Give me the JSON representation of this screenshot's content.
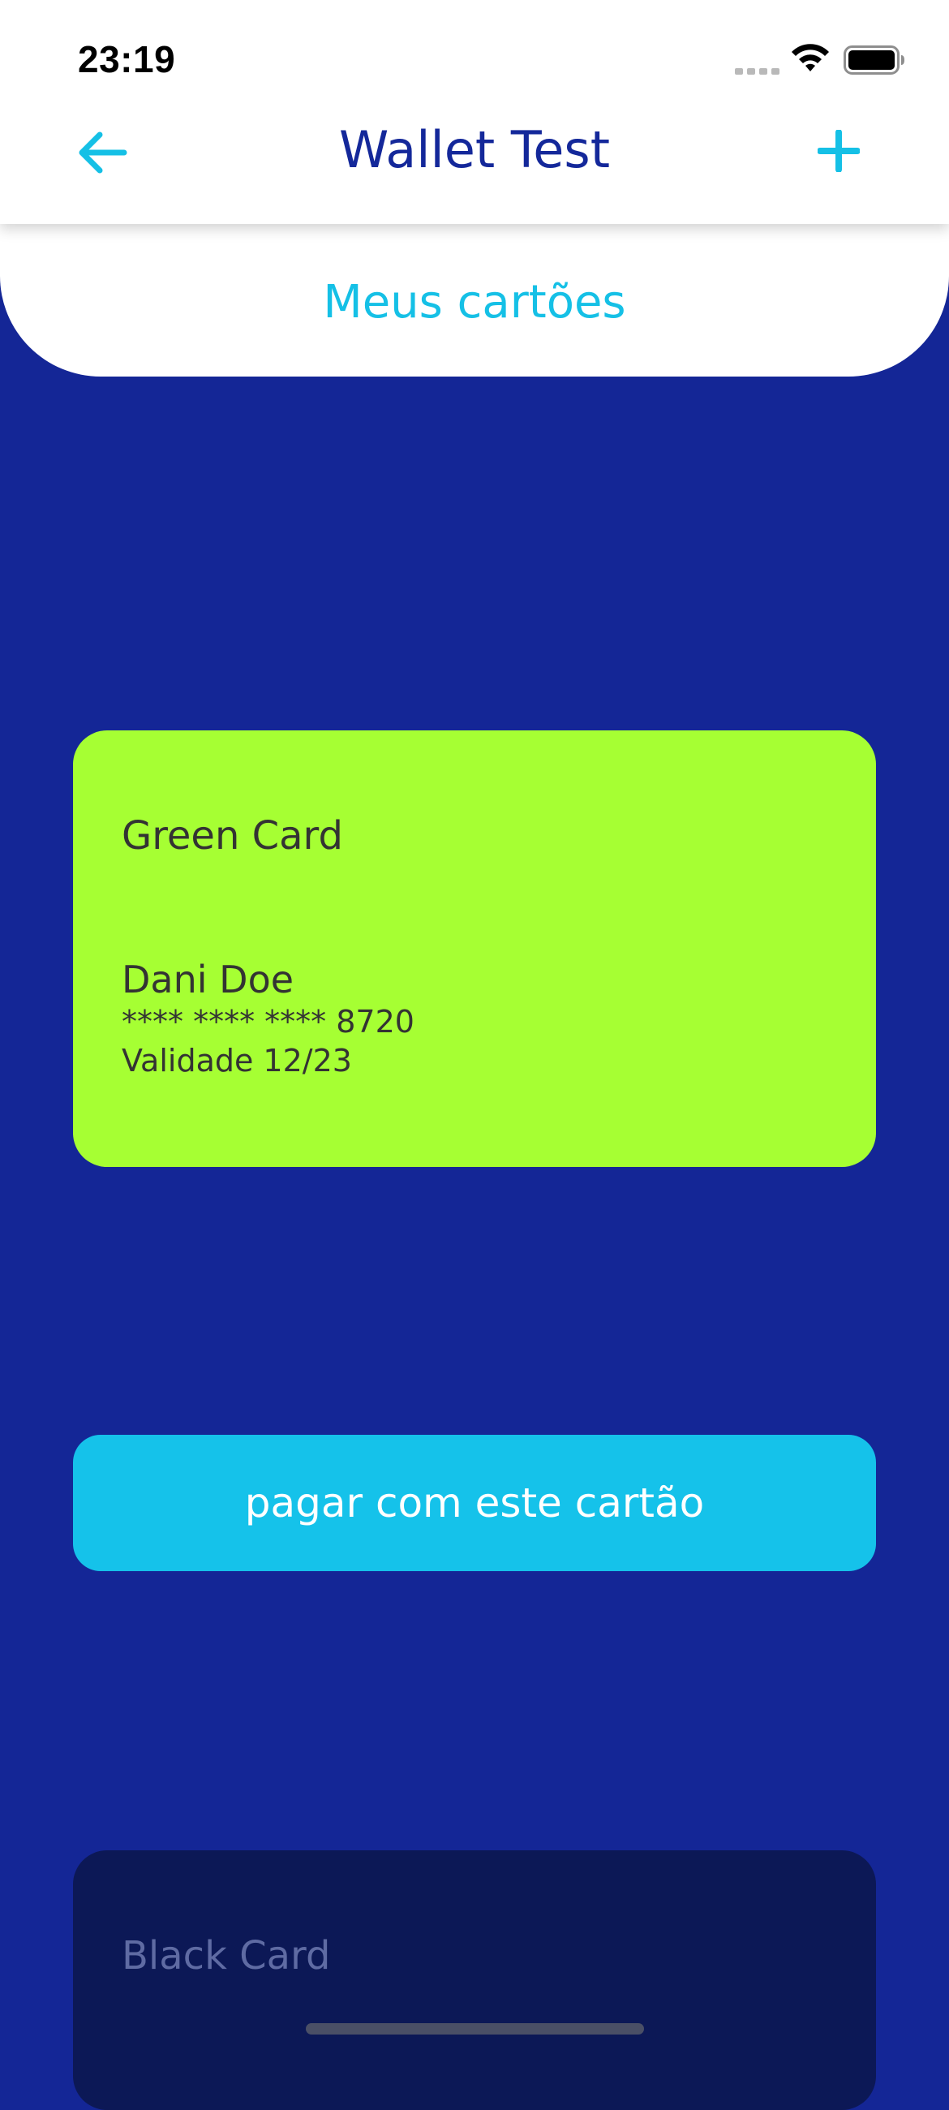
{
  "status_bar": {
    "time": "23:19",
    "icons": [
      "signal-icon",
      "wifi-icon",
      "battery-icon"
    ]
  },
  "header": {
    "title": "Wallet Test",
    "back_icon": "arrow-left-icon",
    "add_icon": "plus-icon"
  },
  "section": {
    "title": "Meus cartões"
  },
  "cards": [
    {
      "name": "Green Card",
      "holder": "Dani Doe",
      "number": "**** **** **** 8720",
      "validity": "Validade 12/23",
      "color": "#a6ff33"
    },
    {
      "name": "Black Card",
      "color": "#0c1856"
    }
  ],
  "pay_button": {
    "label": "pagar com este cartão"
  },
  "colors": {
    "background": "#142696",
    "accent": "#15c2ea",
    "title": "#14289a"
  }
}
